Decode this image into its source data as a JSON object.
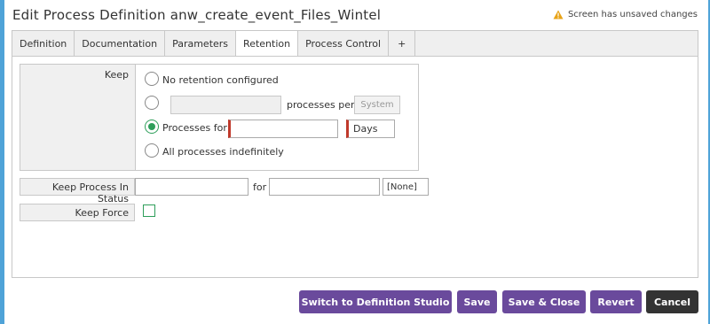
{
  "title": "Edit Process Definition anw_create_event_Files_Wintel",
  "unsaved_notice": "Screen has unsaved changes",
  "tabs": [
    {
      "label": "Definition"
    },
    {
      "label": "Documentation"
    },
    {
      "label": "Parameters"
    },
    {
      "label": "Retention"
    },
    {
      "label": "Process Control"
    },
    {
      "label": "+"
    }
  ],
  "active_tab": "Retention",
  "keep": {
    "label": "Keep",
    "options": {
      "no_retention": "No retention configured",
      "processes_per": "processes per",
      "processes_for": "Processes for",
      "all_indefinitely": "All processes indefinitely"
    },
    "per_system_button": "System",
    "days_value": "Days",
    "selected_option": "processes_for"
  },
  "keep_in_status": {
    "label": "Keep Process In Status",
    "for_label": "for",
    "none_value": "[None]"
  },
  "keep_force": {
    "label": "Keep Force",
    "checked": false
  },
  "footer": {
    "switch_studio": "Switch to Definition Studio",
    "save": "Save",
    "save_close": "Save & Close",
    "revert": "Revert",
    "cancel": "Cancel"
  },
  "colors": {
    "accent_blue": "#4fa3d8",
    "button_purple": "#6a4a9c",
    "button_dark": "#333333",
    "radio_green": "#2e9e5a",
    "required_red": "#c0392b",
    "warning_orange": "#e8a317"
  }
}
